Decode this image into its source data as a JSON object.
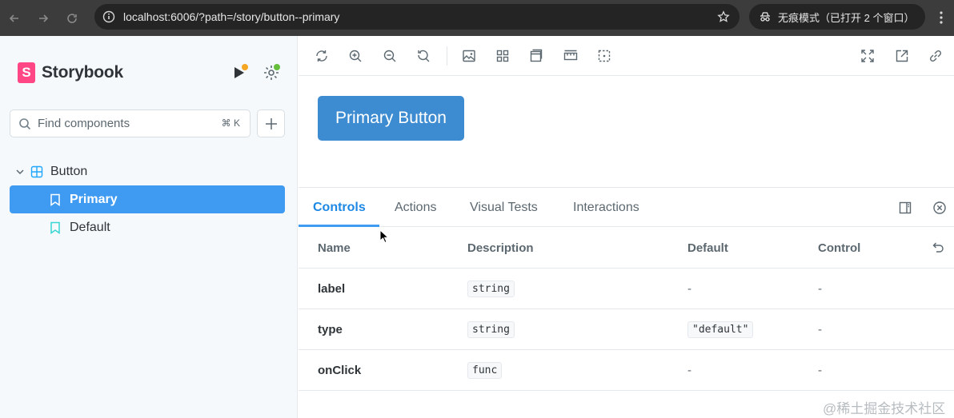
{
  "browser": {
    "url": "localhost:6006/?path=/story/button--primary",
    "incognito_label": "无痕模式（已打开 2 个窗口）"
  },
  "sidebar": {
    "brand": "Storybook",
    "brand_letter": "S",
    "search_placeholder": "Find components",
    "search_shortcut": "⌘ K",
    "group": {
      "label": "Button"
    },
    "items": [
      {
        "label": "Primary",
        "selected": true
      },
      {
        "label": "Default",
        "selected": false
      }
    ]
  },
  "canvas": {
    "button_label": "Primary Button"
  },
  "addons": {
    "tabs": [
      "Controls",
      "Actions",
      "Visual Tests",
      "Interactions"
    ],
    "active_tab": "Controls"
  },
  "args_table": {
    "headers": [
      "Name",
      "Description",
      "Default",
      "Control"
    ],
    "rows": [
      {
        "name": "label",
        "type": "string",
        "default": "-",
        "control": "-"
      },
      {
        "name": "type",
        "type": "string",
        "default": "\"default\"",
        "control": "-"
      },
      {
        "name": "onClick",
        "type": "func",
        "default": "-",
        "control": "-"
      }
    ]
  },
  "watermark": "@稀土掘金技术社区",
  "colors": {
    "accent": "#3f9bf2",
    "brand": "#ff4785",
    "button": "#3d8bd0"
  }
}
